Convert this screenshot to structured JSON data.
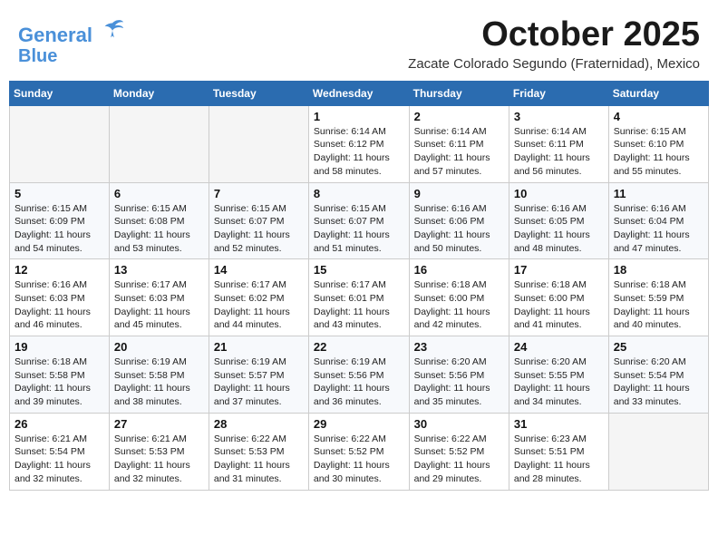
{
  "header": {
    "logo_line1": "General",
    "logo_line2": "Blue",
    "month": "October 2025",
    "location": "Zacate Colorado Segundo (Fraternidad), Mexico"
  },
  "weekdays": [
    "Sunday",
    "Monday",
    "Tuesday",
    "Wednesday",
    "Thursday",
    "Friday",
    "Saturday"
  ],
  "weeks": [
    [
      {
        "day": "",
        "info": ""
      },
      {
        "day": "",
        "info": ""
      },
      {
        "day": "",
        "info": ""
      },
      {
        "day": "1",
        "info": "Sunrise: 6:14 AM\nSunset: 6:12 PM\nDaylight: 11 hours and 58 minutes."
      },
      {
        "day": "2",
        "info": "Sunrise: 6:14 AM\nSunset: 6:11 PM\nDaylight: 11 hours and 57 minutes."
      },
      {
        "day": "3",
        "info": "Sunrise: 6:14 AM\nSunset: 6:11 PM\nDaylight: 11 hours and 56 minutes."
      },
      {
        "day": "4",
        "info": "Sunrise: 6:15 AM\nSunset: 6:10 PM\nDaylight: 11 hours and 55 minutes."
      }
    ],
    [
      {
        "day": "5",
        "info": "Sunrise: 6:15 AM\nSunset: 6:09 PM\nDaylight: 11 hours and 54 minutes."
      },
      {
        "day": "6",
        "info": "Sunrise: 6:15 AM\nSunset: 6:08 PM\nDaylight: 11 hours and 53 minutes."
      },
      {
        "day": "7",
        "info": "Sunrise: 6:15 AM\nSunset: 6:07 PM\nDaylight: 11 hours and 52 minutes."
      },
      {
        "day": "8",
        "info": "Sunrise: 6:15 AM\nSunset: 6:07 PM\nDaylight: 11 hours and 51 minutes."
      },
      {
        "day": "9",
        "info": "Sunrise: 6:16 AM\nSunset: 6:06 PM\nDaylight: 11 hours and 50 minutes."
      },
      {
        "day": "10",
        "info": "Sunrise: 6:16 AM\nSunset: 6:05 PM\nDaylight: 11 hours and 48 minutes."
      },
      {
        "day": "11",
        "info": "Sunrise: 6:16 AM\nSunset: 6:04 PM\nDaylight: 11 hours and 47 minutes."
      }
    ],
    [
      {
        "day": "12",
        "info": "Sunrise: 6:16 AM\nSunset: 6:03 PM\nDaylight: 11 hours and 46 minutes."
      },
      {
        "day": "13",
        "info": "Sunrise: 6:17 AM\nSunset: 6:03 PM\nDaylight: 11 hours and 45 minutes."
      },
      {
        "day": "14",
        "info": "Sunrise: 6:17 AM\nSunset: 6:02 PM\nDaylight: 11 hours and 44 minutes."
      },
      {
        "day": "15",
        "info": "Sunrise: 6:17 AM\nSunset: 6:01 PM\nDaylight: 11 hours and 43 minutes."
      },
      {
        "day": "16",
        "info": "Sunrise: 6:18 AM\nSunset: 6:00 PM\nDaylight: 11 hours and 42 minutes."
      },
      {
        "day": "17",
        "info": "Sunrise: 6:18 AM\nSunset: 6:00 PM\nDaylight: 11 hours and 41 minutes."
      },
      {
        "day": "18",
        "info": "Sunrise: 6:18 AM\nSunset: 5:59 PM\nDaylight: 11 hours and 40 minutes."
      }
    ],
    [
      {
        "day": "19",
        "info": "Sunrise: 6:18 AM\nSunset: 5:58 PM\nDaylight: 11 hours and 39 minutes."
      },
      {
        "day": "20",
        "info": "Sunrise: 6:19 AM\nSunset: 5:58 PM\nDaylight: 11 hours and 38 minutes."
      },
      {
        "day": "21",
        "info": "Sunrise: 6:19 AM\nSunset: 5:57 PM\nDaylight: 11 hours and 37 minutes."
      },
      {
        "day": "22",
        "info": "Sunrise: 6:19 AM\nSunset: 5:56 PM\nDaylight: 11 hours and 36 minutes."
      },
      {
        "day": "23",
        "info": "Sunrise: 6:20 AM\nSunset: 5:56 PM\nDaylight: 11 hours and 35 minutes."
      },
      {
        "day": "24",
        "info": "Sunrise: 6:20 AM\nSunset: 5:55 PM\nDaylight: 11 hours and 34 minutes."
      },
      {
        "day": "25",
        "info": "Sunrise: 6:20 AM\nSunset: 5:54 PM\nDaylight: 11 hours and 33 minutes."
      }
    ],
    [
      {
        "day": "26",
        "info": "Sunrise: 6:21 AM\nSunset: 5:54 PM\nDaylight: 11 hours and 32 minutes."
      },
      {
        "day": "27",
        "info": "Sunrise: 6:21 AM\nSunset: 5:53 PM\nDaylight: 11 hours and 32 minutes."
      },
      {
        "day": "28",
        "info": "Sunrise: 6:22 AM\nSunset: 5:53 PM\nDaylight: 11 hours and 31 minutes."
      },
      {
        "day": "29",
        "info": "Sunrise: 6:22 AM\nSunset: 5:52 PM\nDaylight: 11 hours and 30 minutes."
      },
      {
        "day": "30",
        "info": "Sunrise: 6:22 AM\nSunset: 5:52 PM\nDaylight: 11 hours and 29 minutes."
      },
      {
        "day": "31",
        "info": "Sunrise: 6:23 AM\nSunset: 5:51 PM\nDaylight: 11 hours and 28 minutes."
      },
      {
        "day": "",
        "info": ""
      }
    ]
  ]
}
